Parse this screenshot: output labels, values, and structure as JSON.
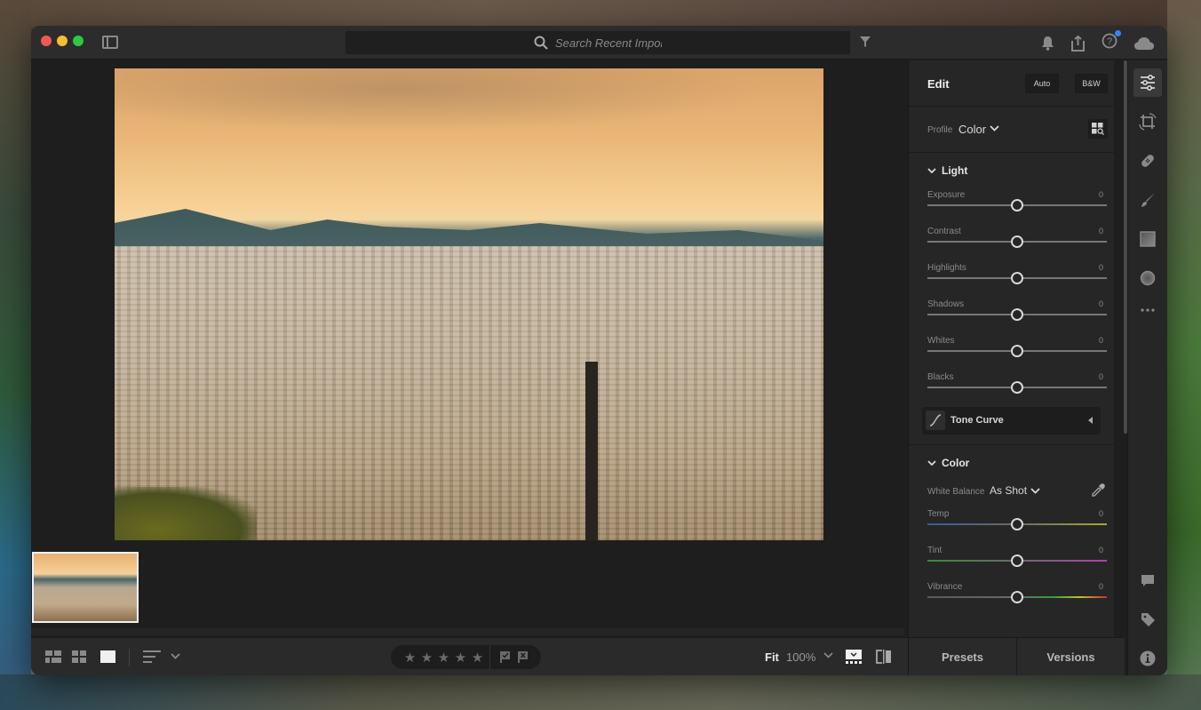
{
  "window": {
    "title_controls": [
      "close",
      "minimize",
      "zoom"
    ],
    "panel_toggle_icon": "sidebar-icon"
  },
  "search": {
    "placeholder": "Search Recent Import",
    "icon": "search-icon",
    "filter_icon": "filter-icon"
  },
  "top_right": {
    "icons": [
      "bell-icon",
      "share-icon",
      "help-icon",
      "cloud-icon"
    ],
    "help_has_notification": true,
    "notification_color": "#3b82f6"
  },
  "photo": {
    "description": "Barcelona cityscape at sunset with Sagrada Familia and Columbus monument"
  },
  "filmstrip": {
    "thumbnails": [
      {
        "selected": true,
        "description": "Barcelona cityscape"
      }
    ]
  },
  "bottombar": {
    "view_modes": [
      "square-grid-icon",
      "photo-grid-icon",
      "detail-view-icon"
    ],
    "active_view": "detail-view-icon",
    "sort_icon": "sort-icon",
    "rating": {
      "stars": 5,
      "value": 0
    },
    "flags": [
      "pick-flag-icon",
      "reject-flag-icon"
    ],
    "fit_label": "Fit",
    "zoom_value": "100%",
    "filmstrip_toggle_icon": "filmstrip-icon",
    "compare_icon": "compare-icon"
  },
  "edit": {
    "title": "Edit",
    "auto_label": "Auto",
    "bw_label": "B&W",
    "profile_label": "Profile",
    "profile_value": "Color",
    "light": {
      "title": "Light",
      "sliders": [
        {
          "label": "Exposure",
          "value": "0",
          "position": 0.5
        },
        {
          "label": "Contrast",
          "value": "0",
          "position": 0.5
        },
        {
          "label": "Highlights",
          "value": "0",
          "position": 0.5
        },
        {
          "label": "Shadows",
          "value": "0",
          "position": 0.5
        },
        {
          "label": "Whites",
          "value": "0",
          "position": 0.5
        },
        {
          "label": "Blacks",
          "value": "0",
          "position": 0.5
        }
      ],
      "tone_curve_label": "Tone Curve"
    },
    "color": {
      "title": "Color",
      "white_balance_label": "White Balance",
      "white_balance_value": "As Shot",
      "sliders": [
        {
          "label": "Temp",
          "value": "0",
          "position": 0.5
        },
        {
          "label": "Tint",
          "value": "0",
          "position": 0.5
        },
        {
          "label": "Vibrance",
          "value": "0",
          "position": 0.5
        }
      ]
    }
  },
  "panel_tabs": {
    "presets": "Presets",
    "versions": "Versions"
  },
  "toolstrip": {
    "tools": [
      "edit-sliders-icon",
      "crop-icon",
      "healing-icon",
      "brush-icon",
      "linear-gradient-icon",
      "radial-gradient-icon",
      "more-icon"
    ],
    "bottom_tools": [
      "comment-icon",
      "keyword-icon",
      "info-icon"
    ],
    "active": "edit-sliders-icon"
  }
}
